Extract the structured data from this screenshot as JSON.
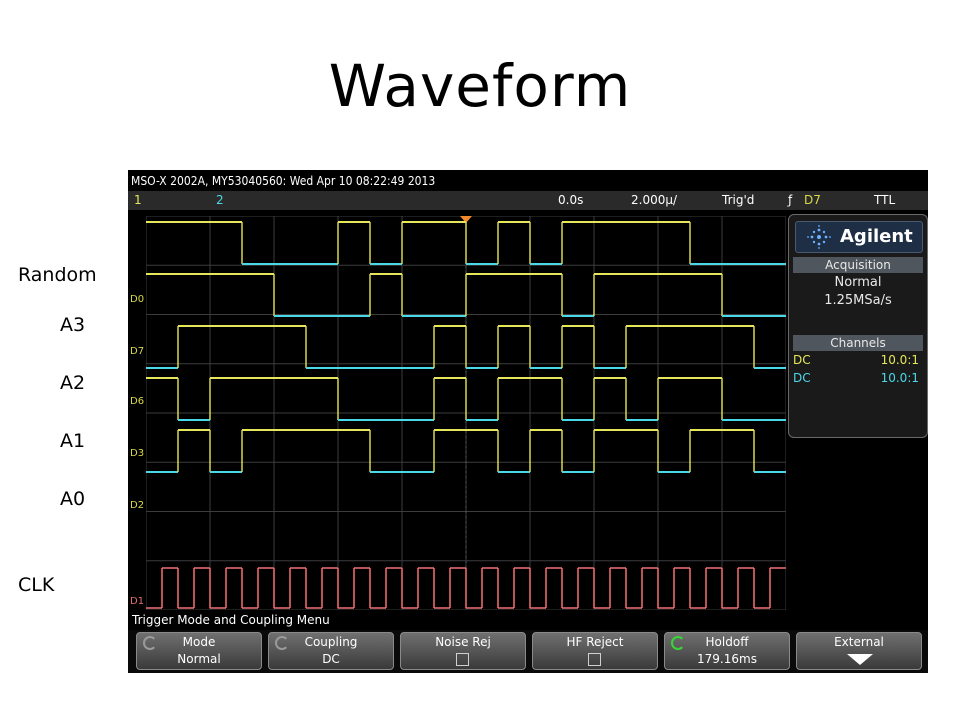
{
  "slide": {
    "title": "Waveform",
    "labels": [
      "Random",
      "A3",
      "A2",
      "A1",
      "A0",
      "CLK"
    ]
  },
  "scope": {
    "info_line": "MSO-X 2002A, MY53040560: Wed Apr 10 08:22:49 2013",
    "status": {
      "ch1": "1",
      "ch2": "2",
      "time_offset": "0.0s",
      "time_per_div": "2.000µ/",
      "trigger_state": "Trig'd",
      "trigger_edge": "ƒ",
      "trigger_source": "D7",
      "logic_level": "TTL"
    },
    "channel_tags": [
      "D0",
      "D7",
      "D6",
      "D3",
      "D2",
      "D1"
    ],
    "panel": {
      "brand": "Agilent",
      "acquisition_header": "Acquisition",
      "acq_mode": "Normal",
      "sample_rate": "1.25MSa/s",
      "channels_header": "Channels",
      "channels": [
        {
          "coupling": "DC",
          "probe": "10.0:1",
          "color": "#e6e65a"
        },
        {
          "coupling": "DC",
          "probe": "10.0:1",
          "color": "#4ad8e8"
        }
      ]
    },
    "menu_title": "Trigger Mode and Coupling Menu",
    "softkeys": [
      {
        "line1": "Mode",
        "line2": "Normal",
        "knob": "gray"
      },
      {
        "line1": "Coupling",
        "line2": "DC",
        "knob": "gray"
      },
      {
        "line1": "Noise Rej",
        "line2": "",
        "checkbox": true
      },
      {
        "line1": "HF Reject",
        "line2": "",
        "checkbox": true
      },
      {
        "line1": "Holdoff",
        "line2": "179.16ms",
        "knob": "green"
      },
      {
        "line1": "External",
        "line2": "",
        "arrow": true
      }
    ],
    "colors": {
      "ch1": "#e6e65a",
      "ch2": "#4ad8e8",
      "clock": "#e86a6a",
      "grid": "#3c3c3c",
      "trigger_marker": "#f08a2a"
    },
    "traces": [
      {
        "name": "Random",
        "bits": [
          1,
          1,
          1,
          0,
          0,
          0,
          1,
          0,
          1,
          1,
          0,
          1,
          0,
          1,
          1,
          1,
          1,
          0,
          0,
          0
        ]
      },
      {
        "name": "A3",
        "bits": [
          1,
          1,
          1,
          1,
          0,
          0,
          0,
          1,
          0,
          0,
          1,
          1,
          1,
          0,
          1,
          1,
          1,
          1,
          0,
          0
        ]
      },
      {
        "name": "A2",
        "bits": [
          0,
          1,
          1,
          1,
          1,
          0,
          0,
          0,
          0,
          1,
          0,
          1,
          0,
          1,
          0,
          1,
          1,
          1,
          1,
          0
        ]
      },
      {
        "name": "A1",
        "bits": [
          1,
          0,
          1,
          1,
          1,
          1,
          0,
          0,
          0,
          1,
          0,
          1,
          1,
          0,
          1,
          0,
          1,
          1,
          0,
          0
        ]
      },
      {
        "name": "A0",
        "bits": [
          0,
          1,
          0,
          1,
          1,
          1,
          1,
          0,
          0,
          1,
          1,
          0,
          1,
          0,
          1,
          1,
          0,
          1,
          1,
          0
        ]
      }
    ]
  }
}
